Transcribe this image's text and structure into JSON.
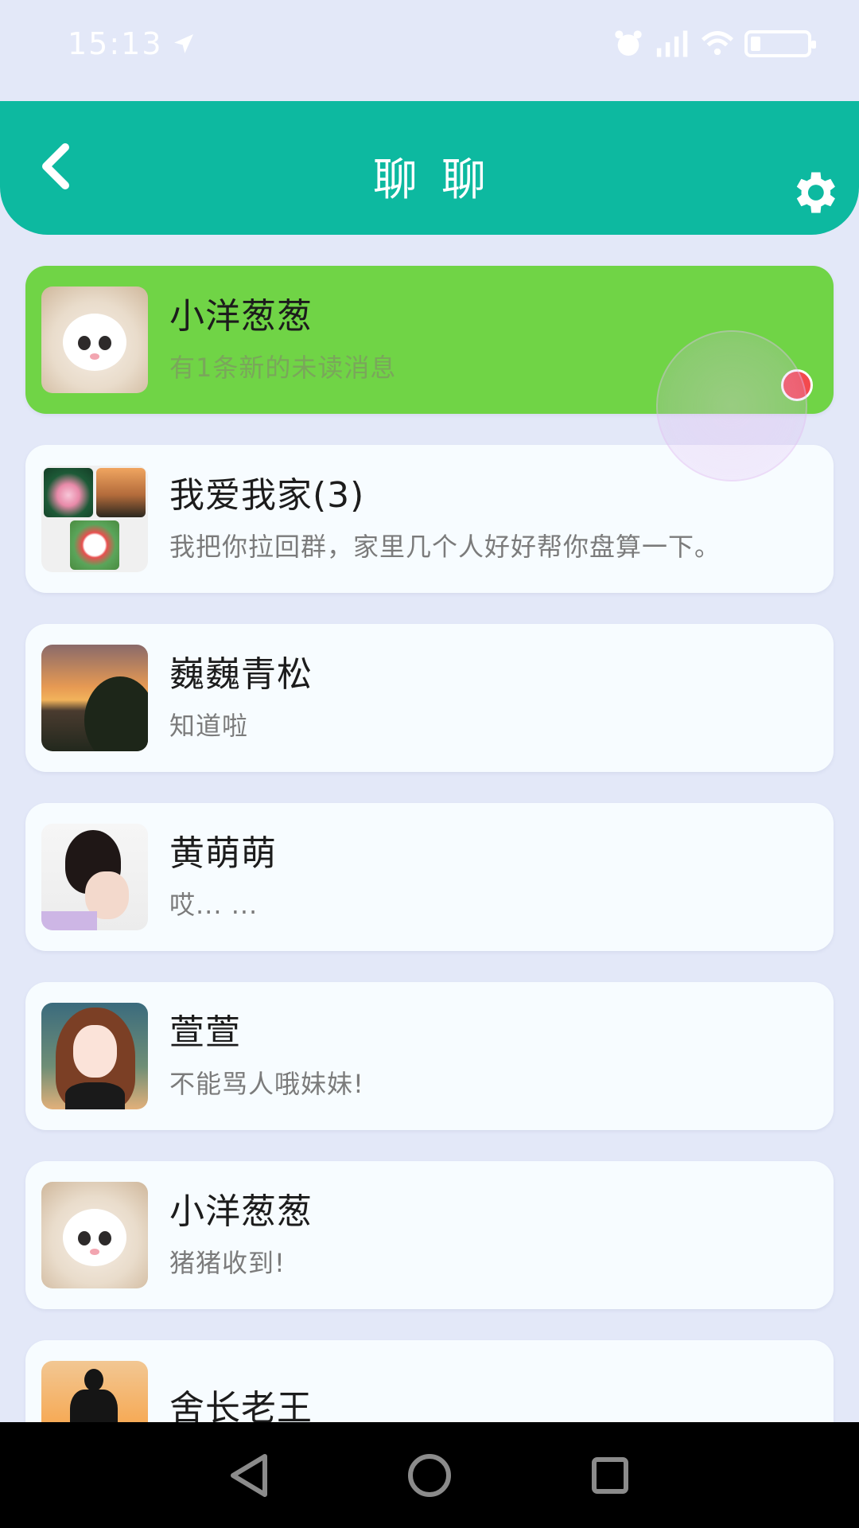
{
  "status": {
    "time": "15:13"
  },
  "header": {
    "title": "聊聊"
  },
  "chats": [
    {
      "name": "小洋葱葱",
      "message": "有1条新的未读消息",
      "avatar": "cat-avatar",
      "active": true,
      "unread": true
    },
    {
      "name": "我爱我家(3)",
      "message": "我把你拉回群，家里几个人好好帮你盘算一下。",
      "avatar": "group-avatar"
    },
    {
      "name": "巍巍青松",
      "message": "知道啦",
      "avatar": "sunset-avatar"
    },
    {
      "name": "黄萌萌",
      "message": "哎... ...",
      "avatar": "girl-avatar"
    },
    {
      "name": "萱萱",
      "message": "不能骂人哦妹妹!",
      "avatar": "anime-avatar"
    },
    {
      "name": "小洋葱葱",
      "message": "猪猪收到!",
      "avatar": "cat-avatar"
    },
    {
      "name": "舍长老王",
      "message": "",
      "avatar": "man-avatar"
    }
  ],
  "colors": {
    "header": "#0db9a0",
    "active_item": "#70d446",
    "unread_dot": "#f34a4e",
    "background": "#e3e8f8"
  },
  "icons": [
    "location-arrow-icon",
    "alarm-icon",
    "signal-icon",
    "wifi-icon",
    "battery-icon",
    "back-chevron-icon",
    "gear-icon",
    "nav-back-icon",
    "nav-home-icon",
    "nav-recents-icon"
  ]
}
